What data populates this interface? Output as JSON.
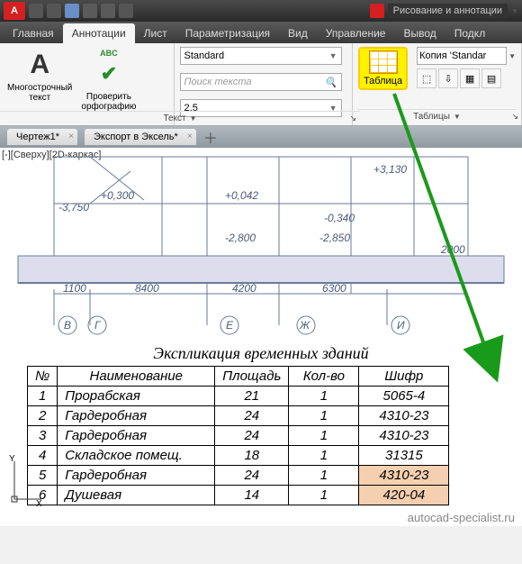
{
  "titlebar": {
    "logo": "A",
    "workspace": "Рисование и аннотации"
  },
  "tabs": {
    "items": [
      "Главная",
      "Аннотации",
      "Лист",
      "Параметризация",
      "Вид",
      "Управление",
      "Вывод",
      "Подкл"
    ],
    "active": 1
  },
  "ribbon": {
    "mtext": {
      "label": "Многострочный\nтекст",
      "glyph": "A"
    },
    "spell": {
      "abc": "ABC",
      "label": "Проверить\nорфографию"
    },
    "style_combo": "Standard",
    "search_placeholder": "Поиск текста",
    "height_combo": "2.5",
    "text_panel": "Текст",
    "table_btn": "Таблица",
    "copy_combo": "Копия 'Standar",
    "tables_panel": "Таблицы"
  },
  "file_tabs": [
    "Чертеж1*",
    "Экспорт в Эксель*"
  ],
  "view_label": "[-][Сверху][2D-каркас]",
  "drawing": {
    "elev1": "+3,130",
    "elev2": "+0,042",
    "elev3": "-0,340",
    "elev4": "-2,800",
    "elev5": "-2,850",
    "elev6": "-3,750",
    "elev7": "+0,300",
    "dim_side": "2000",
    "dim1": "1100",
    "dim2": "8400",
    "dim3": "4200",
    "dim4": "6300",
    "axes": [
      "В",
      "Г",
      "Е",
      "Ж",
      "И"
    ]
  },
  "table_title": "Экспликация временных зданий",
  "table": {
    "headers": [
      "№",
      "Наименование",
      "Площадь",
      "Кол-во",
      "Шифр"
    ],
    "rows": [
      {
        "n": "1",
        "name": "Прорабская",
        "area": "21",
        "qty": "1",
        "code": "5065-4"
      },
      {
        "n": "2",
        "name": "Гардеробная",
        "area": "24",
        "qty": "1",
        "code": "4310-23"
      },
      {
        "n": "3",
        "name": "Гардеробная",
        "area": "24",
        "qty": "1",
        "code": "4310-23"
      },
      {
        "n": "4",
        "name": "Складское помещ.",
        "area": "18",
        "qty": "1",
        "code": "31315"
      },
      {
        "n": "5",
        "name": "Гардеробная",
        "area": "24",
        "qty": "1",
        "code": "4310-23"
      },
      {
        "n": "6",
        "name": "Душевая",
        "area": "14",
        "qty": "1",
        "code": "420-04"
      }
    ]
  },
  "watermark": "autocad-specialist.ru"
}
